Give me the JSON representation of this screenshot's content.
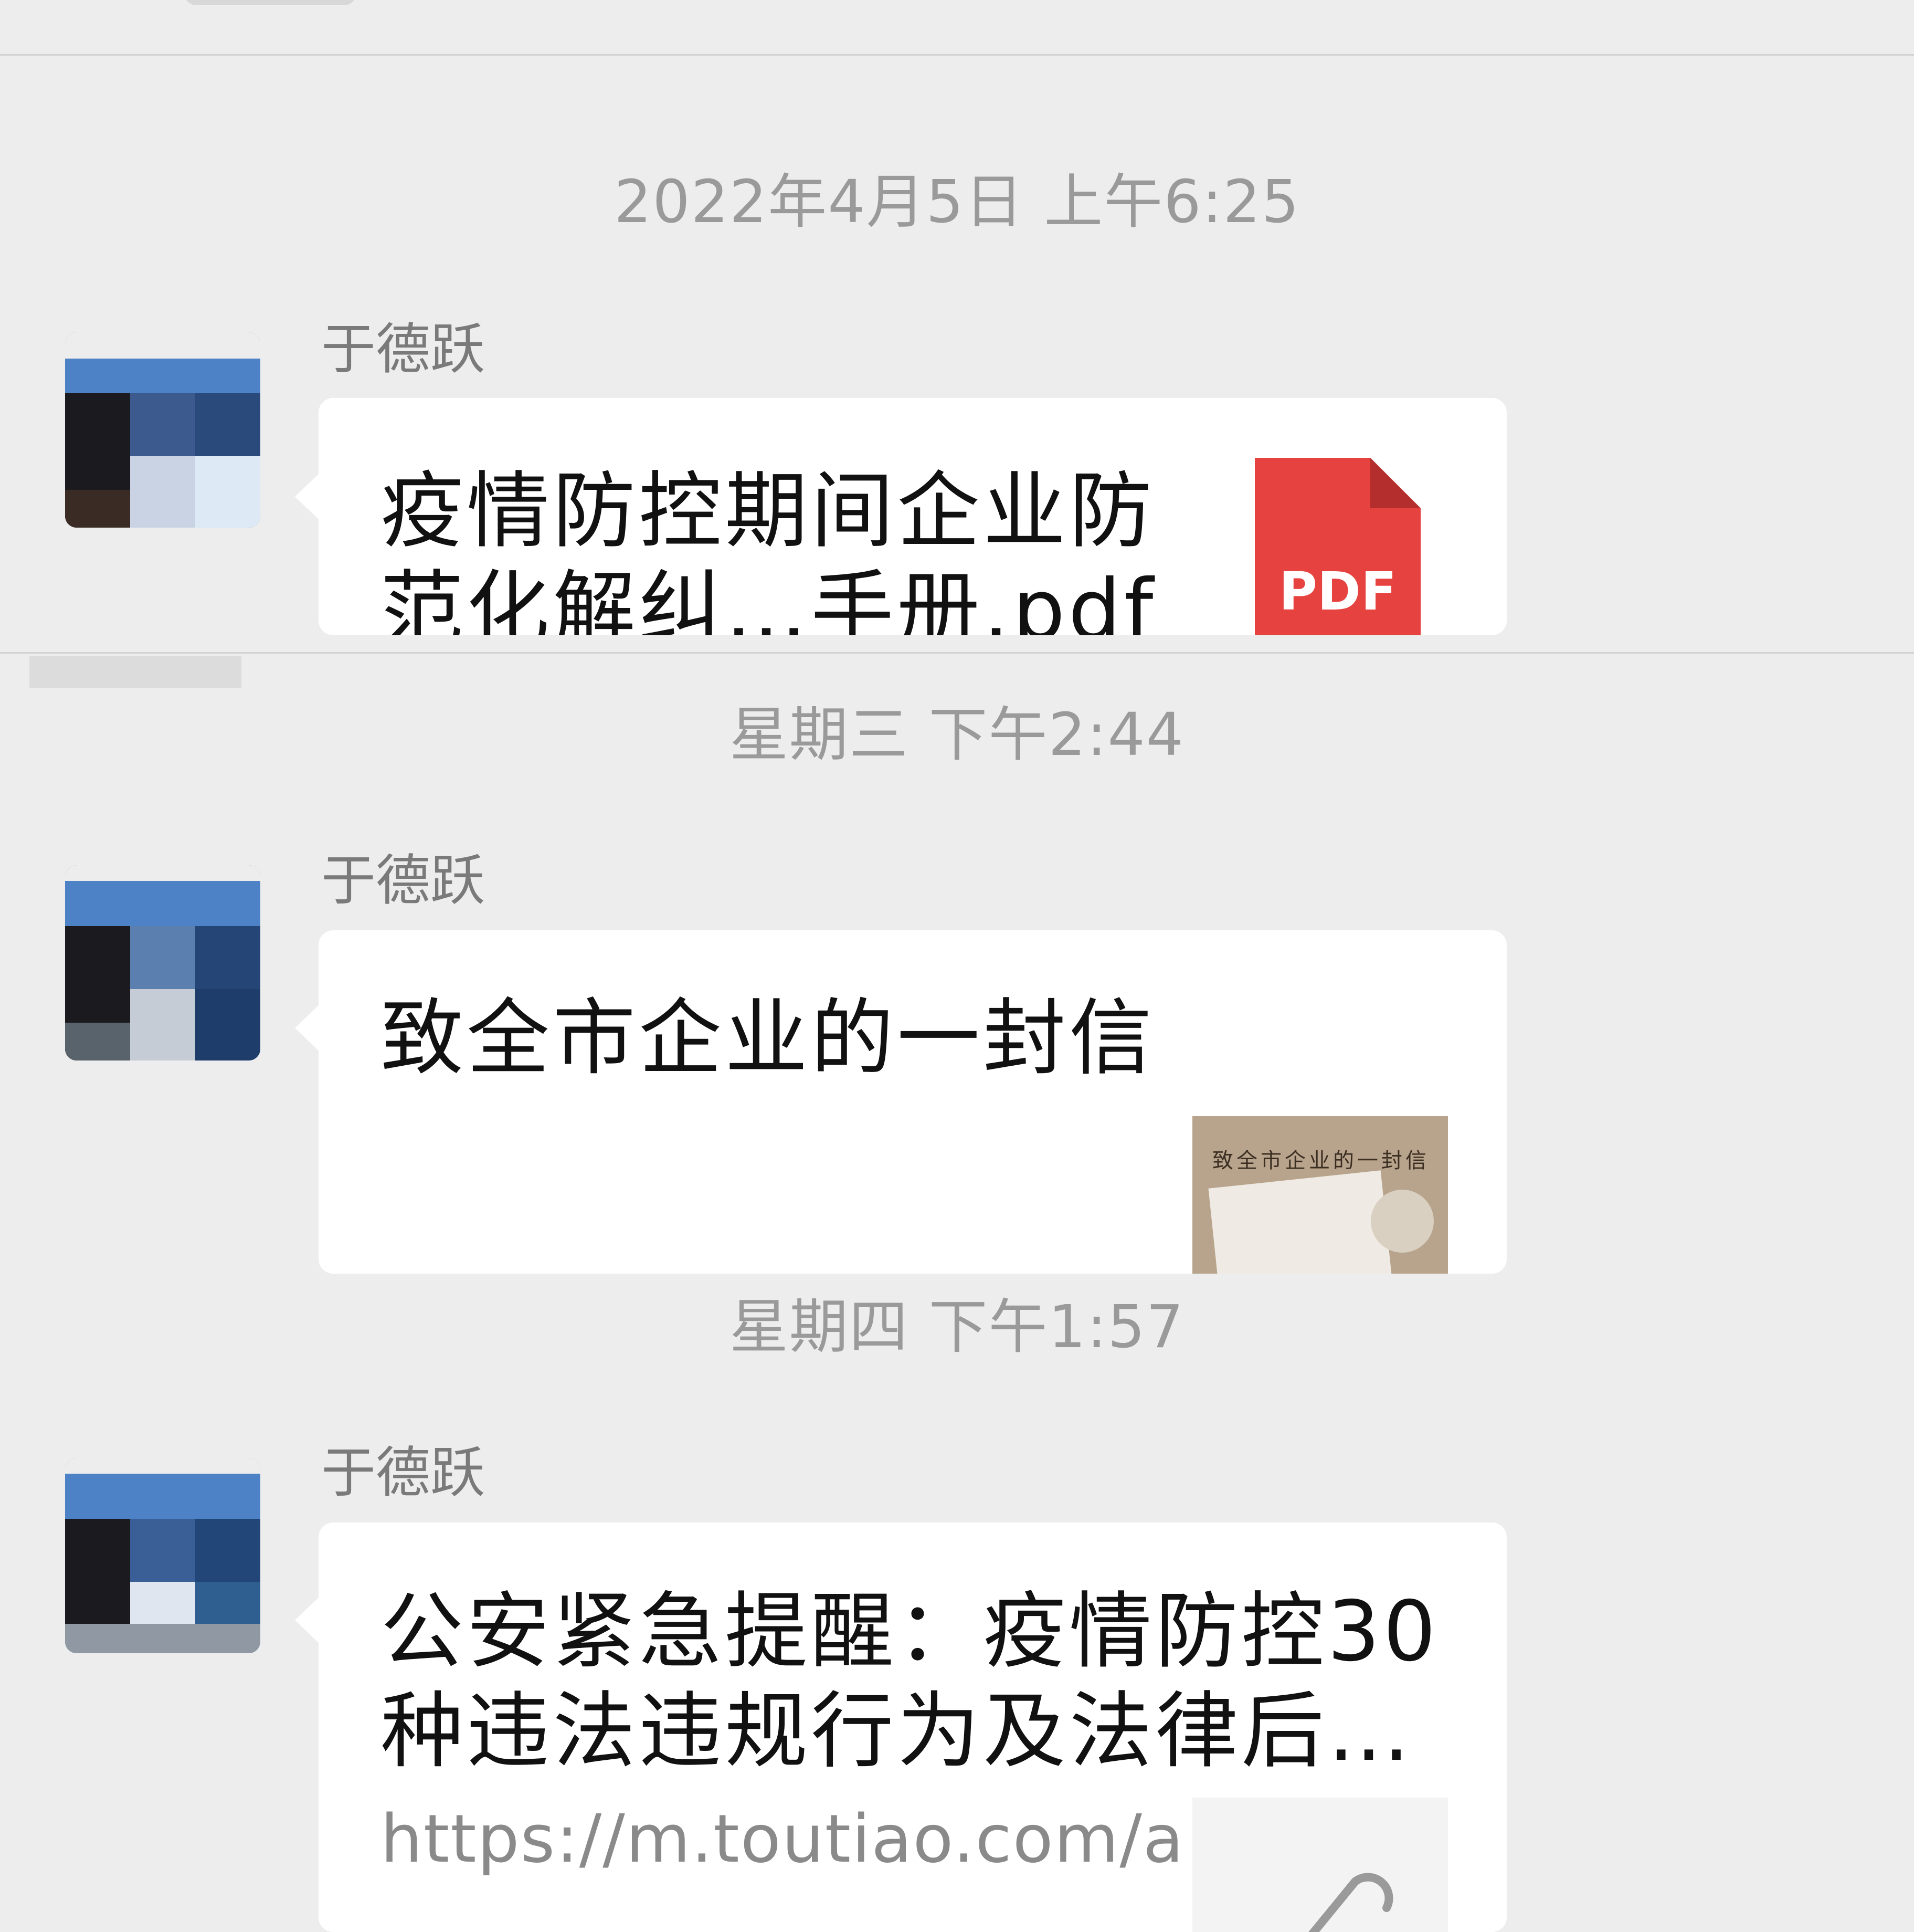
{
  "messages": [
    {
      "timestamp": "2022年4月5日 上午6:25",
      "sender": "于德跃",
      "type": "file",
      "title_lines": [
        "疫情防控期间企业防",
        "范化解纠…手册.pdf"
      ],
      "file_badge": "PDF",
      "file_color": "#e64340",
      "icon": "pdf-file-icon"
    },
    {
      "timestamp": "星期三 下午2:44",
      "sender": "于德跃",
      "type": "link",
      "title_lines": [
        "致全市企业的一封信"
      ],
      "thumbnail_text": "致全市企业的一封信",
      "icon": "article-thumbnail"
    },
    {
      "timestamp": "星期四 下午1:57",
      "sender": "于德跃",
      "type": "link",
      "title_lines": [
        "公安紧急提醒：疫情防控30",
        "种违法违规行为及法律后…"
      ],
      "url": "https://m.toutiao.com/a",
      "icon": "link-icon"
    }
  ],
  "colors": {
    "background": "#ededed",
    "bubble": "#ffffff",
    "timestamp": "#9a9a9a",
    "sender": "#7a7a7a"
  }
}
